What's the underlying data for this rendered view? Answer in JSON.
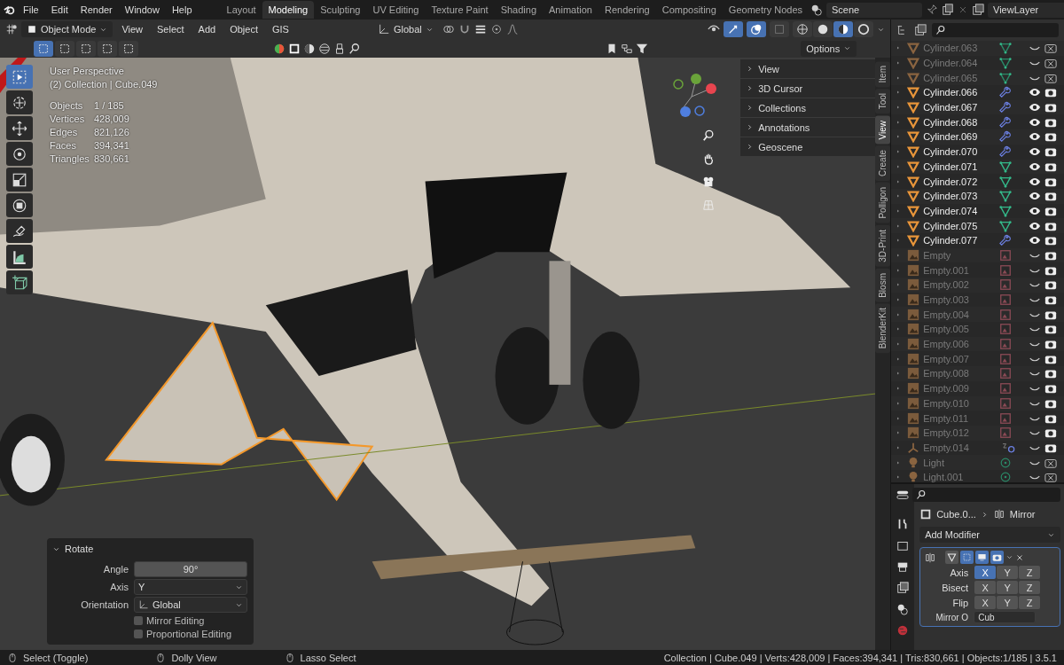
{
  "menu": [
    "File",
    "Edit",
    "Render",
    "Window",
    "Help"
  ],
  "workspaces": [
    {
      "label": "Layout",
      "selected": false
    },
    {
      "label": "Modeling",
      "selected": true
    },
    {
      "label": "Sculpting",
      "selected": false
    },
    {
      "label": "UV Editing",
      "selected": false
    },
    {
      "label": "Texture Paint",
      "selected": false
    },
    {
      "label": "Shading",
      "selected": false
    },
    {
      "label": "Animation",
      "selected": false
    },
    {
      "label": "Rendering",
      "selected": false
    },
    {
      "label": "Compositing",
      "selected": false
    },
    {
      "label": "Geometry Nodes",
      "selected": false
    }
  ],
  "scene": "Scene",
  "view_layer": "ViewLayer",
  "viewport": {
    "mode": "Object Mode",
    "menus": [
      "View",
      "Select",
      "Add",
      "Object",
      "GIS"
    ],
    "orientation": "Global",
    "gizmos_on": true,
    "overlays_on": true,
    "xray": false,
    "shading": [
      {
        "kind": "wireframe",
        "selected": false
      },
      {
        "kind": "solid",
        "selected": false
      },
      {
        "kind": "material",
        "selected": true
      },
      {
        "kind": "rendered",
        "selected": false
      }
    ],
    "select_modes": [
      {
        "selected": true
      },
      {
        "selected": false
      },
      {
        "selected": false
      },
      {
        "selected": false
      },
      {
        "selected": false
      }
    ],
    "options": "Options",
    "view_name": "User Perspective",
    "collection": "(2) Collection | Cube.049",
    "stats": [
      {
        "label": "Objects",
        "value": "1 / 185"
      },
      {
        "label": "Vertices",
        "value": "428,009"
      },
      {
        "label": "Edges",
        "value": "821,126"
      },
      {
        "label": "Faces",
        "value": "394,341"
      },
      {
        "label": "Triangles",
        "value": "830,661"
      }
    ],
    "tools": [
      {
        "kind": "select",
        "selected": true
      },
      {
        "kind": "cursor",
        "selected": false
      },
      {
        "kind": "move",
        "selected": false
      },
      {
        "kind": "rotate",
        "selected": false
      },
      {
        "kind": "scale",
        "selected": false
      },
      {
        "kind": "transform",
        "selected": false
      },
      {
        "kind": "annotate",
        "selected": false
      },
      {
        "kind": "measure",
        "selected": false
      },
      {
        "kind": "add-cube",
        "selected": false
      }
    ],
    "sidebar_tabs": [
      {
        "label": "Item",
        "selected": false
      },
      {
        "label": "Tool",
        "selected": false
      },
      {
        "label": "View",
        "selected": true
      },
      {
        "label": "Create",
        "selected": false
      },
      {
        "label": "Polligon",
        "selected": false
      },
      {
        "label": "3D-Print",
        "selected": false
      },
      {
        "label": "Blosm",
        "selected": false
      },
      {
        "label": "BlenderKit",
        "selected": false
      }
    ],
    "sidebar_panels": [
      {
        "label": "View",
        "expanded": false
      },
      {
        "label": "3D Cursor",
        "expanded": false
      },
      {
        "label": "Collections",
        "expanded": false
      },
      {
        "label": "Annotations",
        "expanded": false
      },
      {
        "label": "Geoscene",
        "expanded": false
      }
    ],
    "operator_panel": {
      "title": "Rotate",
      "expanded": true,
      "fields": [
        {
          "label": "Angle",
          "value": "90°",
          "kind": "number"
        },
        {
          "label": "Axis",
          "value": "Y",
          "kind": "dropdown"
        },
        {
          "label": "Orientation",
          "value": "Global",
          "kind": "orientation"
        }
      ],
      "options": [
        {
          "label": "Mirror Editing",
          "checked": false
        },
        {
          "label": "Proportional Editing",
          "checked": false
        }
      ]
    }
  },
  "outliner": {
    "rows": [
      {
        "name": "Cylinder.063",
        "kind": "mesh",
        "badge": {
          "kind": "mesh"
        },
        "visible": false,
        "renderable": false
      },
      {
        "name": "Cylinder.064",
        "kind": "mesh",
        "badge": {
          "kind": "mesh"
        },
        "visible": false,
        "renderable": false
      },
      {
        "name": "Cylinder.065",
        "kind": "mesh",
        "badge": {
          "kind": "mesh"
        },
        "visible": false,
        "renderable": false
      },
      {
        "name": "Cylinder.066",
        "kind": "mesh",
        "badge": {
          "kind": "modifier"
        },
        "visible": true,
        "renderable": true
      },
      {
        "name": "Cylinder.067",
        "kind": "mesh",
        "badge": {
          "kind": "modifier"
        },
        "visible": true,
        "renderable": true
      },
      {
        "name": "Cylinder.068",
        "kind": "mesh",
        "badge": {
          "kind": "modifier"
        },
        "visible": true,
        "renderable": true
      },
      {
        "name": "Cylinder.069",
        "kind": "mesh",
        "badge": {
          "kind": "modifier"
        },
        "visible": true,
        "renderable": true
      },
      {
        "name": "Cylinder.070",
        "kind": "mesh",
        "badge": {
          "kind": "modifier"
        },
        "visible": true,
        "renderable": true
      },
      {
        "name": "Cylinder.071",
        "kind": "mesh",
        "badge": {
          "kind": "mesh"
        },
        "visible": true,
        "renderable": true
      },
      {
        "name": "Cylinder.072",
        "kind": "mesh",
        "badge": {
          "kind": "mesh"
        },
        "visible": true,
        "renderable": true
      },
      {
        "name": "Cylinder.073",
        "kind": "mesh",
        "badge": {
          "kind": "mesh"
        },
        "visible": true,
        "renderable": true
      },
      {
        "name": "Cylinder.074",
        "kind": "mesh",
        "badge": {
          "kind": "mesh"
        },
        "visible": true,
        "renderable": true
      },
      {
        "name": "Cylinder.075",
        "kind": "mesh",
        "badge": {
          "kind": "mesh"
        },
        "visible": true,
        "renderable": true
      },
      {
        "name": "Cylinder.077",
        "kind": "mesh",
        "badge": {
          "kind": "modifier"
        },
        "visible": true,
        "renderable": true
      },
      {
        "name": "Empty",
        "kind": "empty-image",
        "badge": {
          "kind": "image"
        },
        "visible": false,
        "renderable": true
      },
      {
        "name": "Empty.001",
        "kind": "empty-image",
        "badge": {
          "kind": "image"
        },
        "visible": false,
        "renderable": true
      },
      {
        "name": "Empty.002",
        "kind": "empty-image",
        "badge": {
          "kind": "image"
        },
        "visible": false,
        "renderable": true
      },
      {
        "name": "Empty.003",
        "kind": "empty-image",
        "badge": {
          "kind": "image"
        },
        "visible": false,
        "renderable": true
      },
      {
        "name": "Empty.004",
        "kind": "empty-image",
        "badge": {
          "kind": "image"
        },
        "visible": false,
        "renderable": true
      },
      {
        "name": "Empty.005",
        "kind": "empty-image",
        "badge": {
          "kind": "image"
        },
        "visible": false,
        "renderable": true
      },
      {
        "name": "Empty.006",
        "kind": "empty-image",
        "badge": {
          "kind": "image"
        },
        "visible": false,
        "renderable": true
      },
      {
        "name": "Empty.007",
        "kind": "empty-image",
        "badge": {
          "kind": "image"
        },
        "visible": false,
        "renderable": true
      },
      {
        "name": "Empty.008",
        "kind": "empty-image",
        "badge": {
          "kind": "image"
        },
        "visible": false,
        "renderable": true
      },
      {
        "name": "Empty.009",
        "kind": "empty-image",
        "badge": {
          "kind": "image"
        },
        "visible": false,
        "renderable": true
      },
      {
        "name": "Empty.010",
        "kind": "empty-image",
        "badge": {
          "kind": "image"
        },
        "visible": false,
        "renderable": true
      },
      {
        "name": "Empty.011",
        "kind": "empty-image",
        "badge": {
          "kind": "image"
        },
        "visible": false,
        "renderable": true
      },
      {
        "name": "Empty.012",
        "kind": "empty-image",
        "badge": {
          "kind": "image"
        },
        "visible": false,
        "renderable": true
      },
      {
        "name": "Empty.014",
        "kind": "empty-axes",
        "badge": {
          "kind": "constraint"
        },
        "visible": false,
        "renderable": true
      },
      {
        "name": "Light",
        "kind": "light",
        "badge": {
          "kind": "light"
        },
        "visible": false,
        "renderable": false
      },
      {
        "name": "Light.001",
        "kind": "light",
        "badge": {
          "kind": "light"
        },
        "visible": false,
        "renderable": false
      }
    ]
  },
  "properties": {
    "object": "Cube.0...",
    "modifier": "Mirror",
    "add_modifier": "Add Modifier",
    "modifier_toggles": [
      {
        "kind": "edit-mode",
        "on": false
      },
      {
        "kind": "on-cage",
        "on": true
      },
      {
        "kind": "viewport",
        "on": true
      },
      {
        "kind": "render",
        "on": true
      }
    ],
    "axis_rows": [
      {
        "label": "Axis",
        "buttons": [
          {
            "label": "X",
            "selected": true
          },
          {
            "label": "Y",
            "selected": false
          },
          {
            "label": "Z",
            "selected": false
          }
        ]
      },
      {
        "label": "Bisect",
        "buttons": [
          {
            "label": "X",
            "selected": false
          },
          {
            "label": "Y",
            "selected": false
          },
          {
            "label": "Z",
            "selected": false
          }
        ]
      },
      {
        "label": "Flip",
        "buttons": [
          {
            "label": "X",
            "selected": false
          },
          {
            "label": "Y",
            "selected": false
          },
          {
            "label": "Z",
            "selected": false
          }
        ]
      }
    ],
    "mirror_object_label": "Mirror O",
    "mirror_object_value": "Cub"
  },
  "status_bar": {
    "hints": [
      "Select (Toggle)",
      "Dolly View",
      "Lasso Select"
    ],
    "info": "Collection | Cube.049 | Verts:428,009 | Faces:394,341 | Tris:830,661 | Objects:1/185 | 3.5.1"
  }
}
